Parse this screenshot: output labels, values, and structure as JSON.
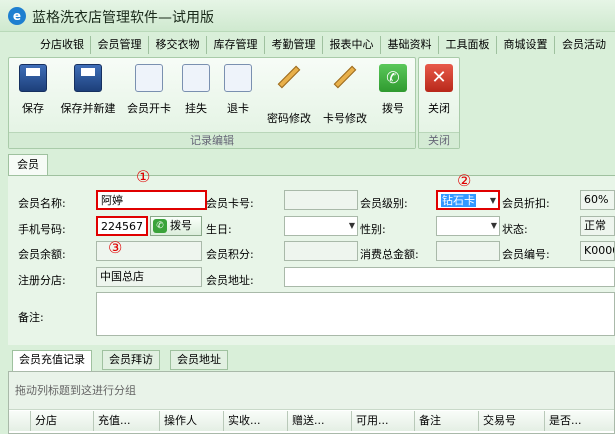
{
  "app": {
    "title": "蓝格洗衣店管理软件—试用版"
  },
  "menu": [
    "分店收银",
    "会员管理",
    "移交衣物",
    "库存管理",
    "考勤管理",
    "报表中心",
    "基础资料",
    "工具面板",
    "商城设置",
    "会员活动"
  ],
  "ribbon": {
    "record_buttons": [
      "保存",
      "保存并新建",
      "会员开卡",
      "挂失",
      "退卡",
      "密码修改",
      "卡号修改",
      "拨号"
    ],
    "record_caption": "记录编辑",
    "close_button": "关闭",
    "close_caption": "关闭"
  },
  "tab": {
    "label": "会员"
  },
  "form": {
    "name_label": "会员名称:",
    "name_value": "阿婷",
    "card_label": "会员卡号:",
    "card_value": "",
    "level_label": "会员级别:",
    "level_value": "钻石卡",
    "discount_label": "会员折扣:",
    "discount_value": "60%",
    "phone_label": "手机号码:",
    "phone_value": "224567",
    "dial_label": "拨号",
    "birthday_label": "生日:",
    "birthday_value": "",
    "gender_label": "性别:",
    "gender_value": "",
    "status_label": "状态:",
    "status_value": "正常",
    "balance_label": "会员余额:",
    "balance_value": "",
    "points_label": "会员积分:",
    "points_value": "",
    "consume_label": "消费总金额:",
    "consume_value": "",
    "member_no_label": "会员编号:",
    "member_no_value": "K0000",
    "branch_label": "注册分店:",
    "branch_value": "中国总店",
    "address_label": "会员地址:",
    "address_value": "",
    "note_label": "备注:",
    "note_value": ""
  },
  "annotations": {
    "mark1": "①",
    "mark2": "②",
    "mark3": "③"
  },
  "subtabs": [
    "会员充值记录",
    "会员拜访",
    "会员地址"
  ],
  "grid": {
    "group_hint": "拖动列标题到这进行分组",
    "columns": [
      "分店",
      "充值...",
      "操作人",
      "实收...",
      "赠送...",
      "可用...",
      "备注",
      "交易号",
      "是否..."
    ]
  },
  "colors": {
    "background": "#d9efd9",
    "highlight": "#e00000",
    "selection": "#3399ff"
  }
}
